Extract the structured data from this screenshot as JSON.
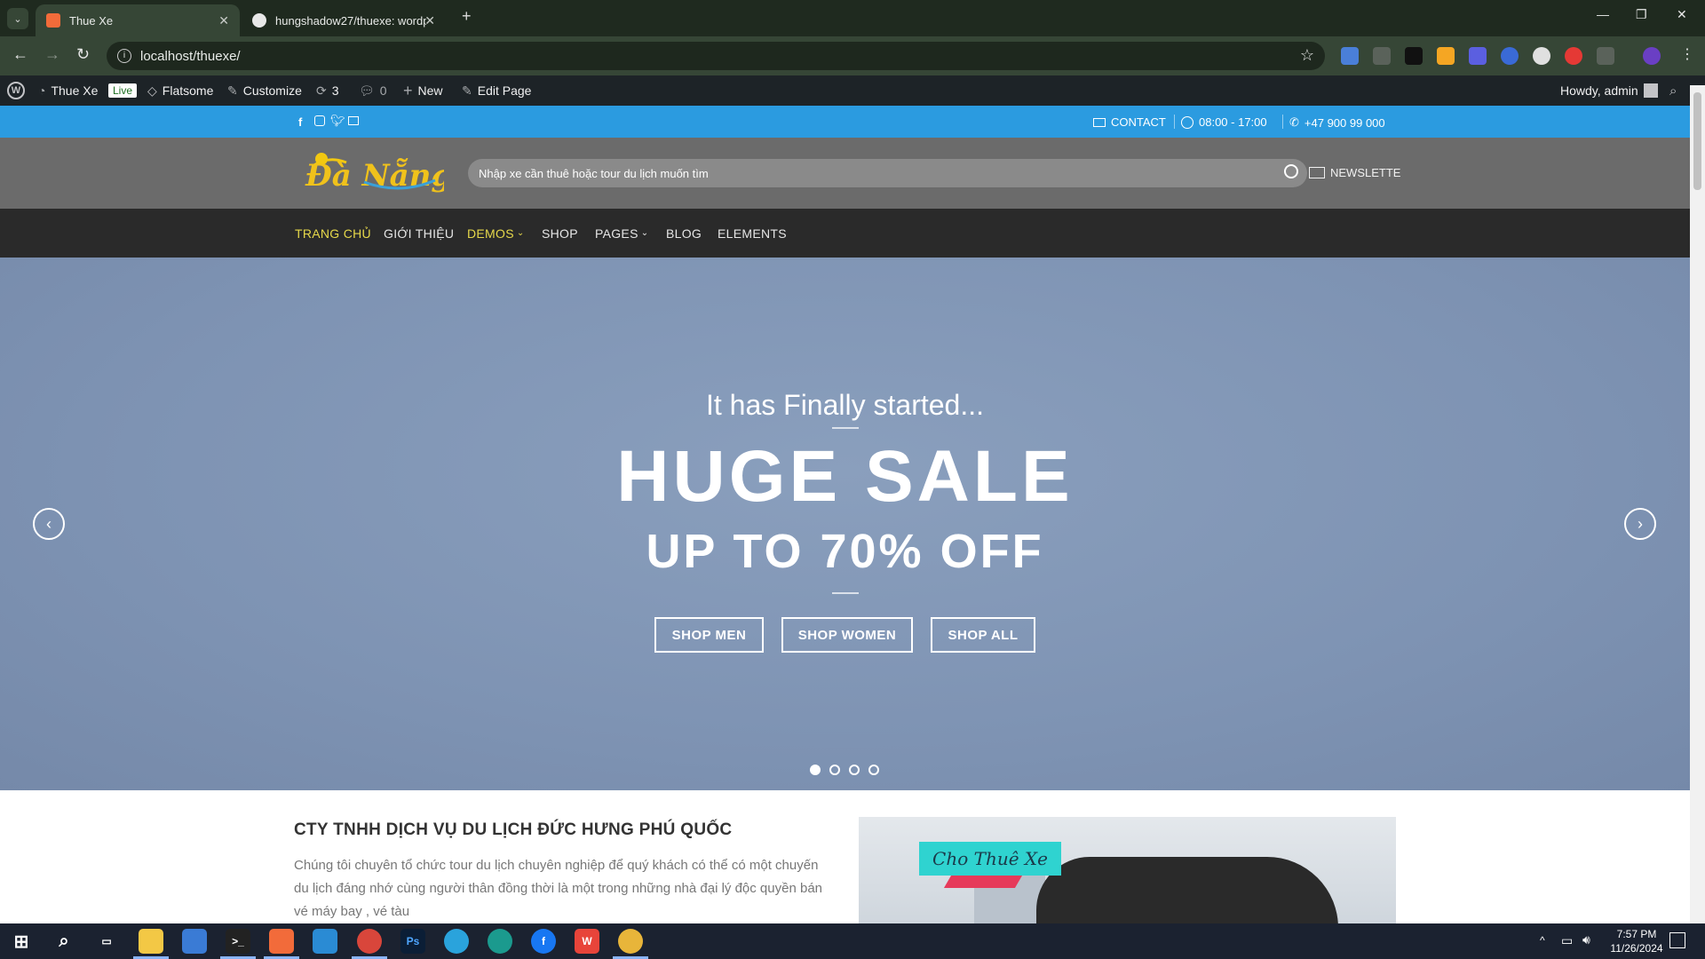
{
  "browser": {
    "tabs": [
      {
        "title": "Thue Xe",
        "active": true
      },
      {
        "title": "hungshadow27/thuexe: wordpr",
        "active": false
      }
    ],
    "url": "localhost/thuexe/"
  },
  "wp_admin_bar": {
    "site_name": "Thue Xe",
    "live_badge": "Live",
    "theme": "Flatsome",
    "customize": "Customize",
    "updates_count": "3",
    "comments_count": "0",
    "new": "New",
    "edit_page": "Edit Page",
    "howdy": "Howdy, admin"
  },
  "top_bar": {
    "contact": "CONTACT",
    "hours": "08:00 - 17:00",
    "phone": "+47 900 99 000"
  },
  "header": {
    "logo_text": "Đà Nẵng",
    "search_placeholder": "Nhập xe cần thuê hoặc tour du lịch muốn tìm",
    "newsletter": "NEWSLETTE"
  },
  "nav": {
    "items": [
      {
        "label": "TRANG CHỦ"
      },
      {
        "label": "GIỚI THIỆU"
      },
      {
        "label": "DEMOS"
      },
      {
        "label": "SHOP"
      },
      {
        "label": "PAGES"
      },
      {
        "label": "BLOG"
      },
      {
        "label": "ELEMENTS"
      }
    ]
  },
  "hero": {
    "kicker": "It has Finally started...",
    "headline": "HUGE SALE",
    "subheadline": "UP TO 70% OFF",
    "buttons": [
      "SHOP MEN",
      "SHOP WOMEN",
      "SHOP ALL"
    ],
    "slides": 4,
    "active_slide": 1
  },
  "company": {
    "title": "CTY TNHH DỊCH VỤ DU LỊCH ĐỨC HƯNG PHÚ QUỐC",
    "body": "Chúng tôi chuyên tổ chức tour du lịch chuyên nghiệp để quý khách có thể có một chuyến du lịch đáng nhớ cùng người thân đồng thời là một trong những nhà đại lý độc quyền bán vé máy bay , vé tàu",
    "banner_label": "Cho Thuê Xe"
  },
  "taskbar": {
    "time": "7:57 PM",
    "date": "11/26/2024"
  },
  "colors": {
    "topbar": "#2b9be0",
    "nav_active": "#e6d84a",
    "header": "#6b6b6b"
  }
}
